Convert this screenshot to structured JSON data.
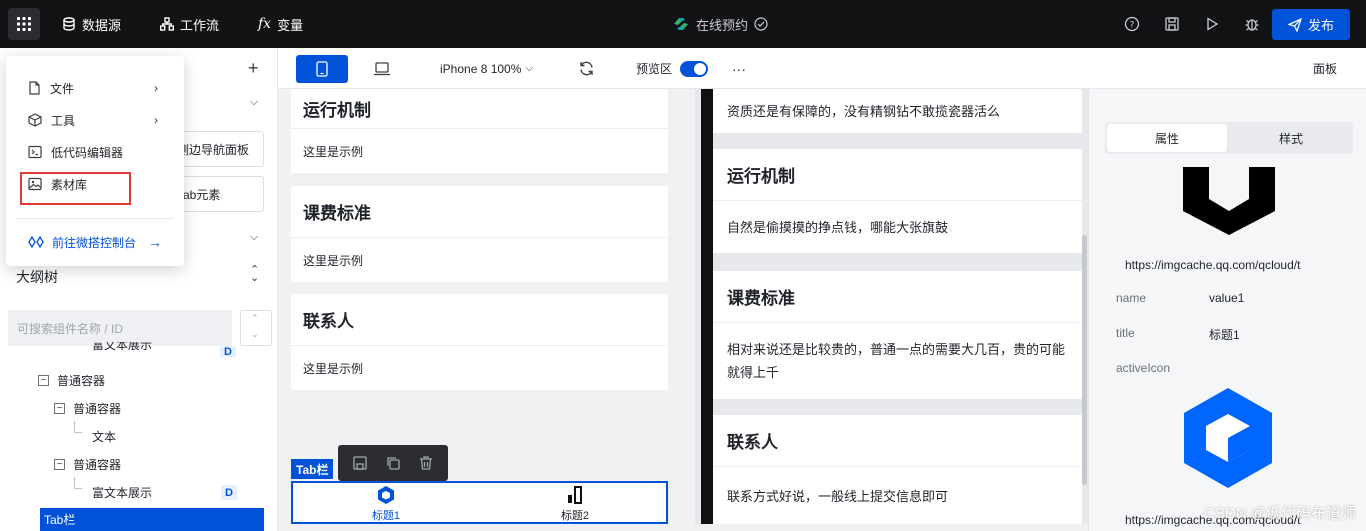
{
  "topbar": {
    "datasource": "数据源",
    "workflow": "工作流",
    "variable": "变量",
    "project_title": "在线预约",
    "publish": "发布"
  },
  "menu": {
    "file": "文件",
    "tools": "工具",
    "lowcode_editor": "低代码编辑器",
    "assets": "素材库",
    "goto_console": "前往微搭控制台"
  },
  "left": {
    "side_nav_button": "侧边导航面板",
    "tab_element_button": "Tab元素",
    "outline_title": "大纲树",
    "search_placeholder": "可搜索组件名称 / ID",
    "tree": [
      "富文本展示",
      "普通容器",
      "普通容器",
      "文本",
      "普通容器",
      "富文本展示",
      "Tab栏"
    ]
  },
  "toolbar": {
    "device": "iPhone 8 100%",
    "preview": "预览区",
    "more": "···",
    "panel": "面板"
  },
  "canvas": {
    "cards": [
      {
        "title": "运行机制",
        "body": "这里是示例"
      },
      {
        "title": "课费标准",
        "body": "这里是示例"
      },
      {
        "title": "联系人",
        "body": "这里是示例"
      }
    ],
    "tab_label": "Tab栏",
    "tabs": [
      "标题1",
      "标题2"
    ]
  },
  "phone": {
    "top_text": "资质还是有保障的，没有精钢钻不敢揽瓷器活么",
    "cards": [
      {
        "title": "运行机制",
        "body": "自然是偷摸摸的挣点钱，哪能大张旗鼓"
      },
      {
        "title": "课费标准",
        "body": "相对来说还是比较贵的，普通一点的需要大几百，贵的可能就得上千"
      },
      {
        "title": "联系人",
        "body": "联系方式好说，一般线上提交信息即可"
      }
    ]
  },
  "right": {
    "tab_props": "属性",
    "tab_style": "样式",
    "url1": "https://imgcache.qq.com/qcloud/t",
    "name_label": "name",
    "name_value": "value1",
    "title_label": "title",
    "title_value": "标题1",
    "activeicon_label": "activeIcon",
    "url2": "https://imgcache.qq.com/qcloud/t"
  },
  "watermark": "CSDN @低代码布道师",
  "colors": {
    "primary": "#0052d9",
    "topbar": "#121314",
    "highlight": "#e03a3a"
  }
}
